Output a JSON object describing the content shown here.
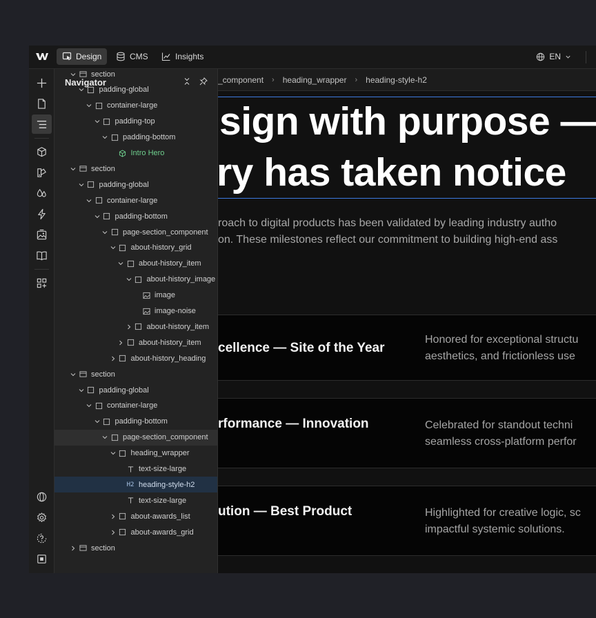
{
  "topbar": {
    "tabs": [
      {
        "label": "Design",
        "icon": "design-cursor-icon",
        "active": true
      },
      {
        "label": "CMS",
        "icon": "database-icon",
        "active": false
      },
      {
        "label": "Insights",
        "icon": "chart-line-icon",
        "active": false
      }
    ],
    "language": "EN"
  },
  "navigator": {
    "title": "Navigator",
    "rows": [
      {
        "label": "section",
        "depth": 0,
        "caret": "down",
        "icon": "section-icon"
      },
      {
        "label": "padding-global",
        "depth": 1,
        "caret": "down",
        "icon": "box-icon"
      },
      {
        "label": "container-large",
        "depth": 2,
        "caret": "down",
        "icon": "box-icon"
      },
      {
        "label": "padding-top",
        "depth": 3,
        "caret": "down",
        "icon": "box-icon"
      },
      {
        "label": "padding-bottom",
        "depth": 4,
        "caret": "down",
        "icon": "box-icon"
      },
      {
        "label": "Intro Hero",
        "depth": 5,
        "caret": "none",
        "icon": "component-icon",
        "state": "component"
      },
      {
        "label": "section",
        "depth": 0,
        "caret": "down",
        "icon": "section-icon"
      },
      {
        "label": "padding-global",
        "depth": 1,
        "caret": "down",
        "icon": "box-icon"
      },
      {
        "label": "container-large",
        "depth": 2,
        "caret": "down",
        "icon": "box-icon"
      },
      {
        "label": "padding-bottom",
        "depth": 3,
        "caret": "down",
        "icon": "box-icon"
      },
      {
        "label": "page-section_component",
        "depth": 4,
        "caret": "down",
        "icon": "box-icon"
      },
      {
        "label": "about-history_grid",
        "depth": 5,
        "caret": "down",
        "icon": "box-icon"
      },
      {
        "label": "about-history_item",
        "depth": 6,
        "caret": "down",
        "icon": "box-icon"
      },
      {
        "label": "about-history_image",
        "depth": 7,
        "caret": "down",
        "icon": "box-icon"
      },
      {
        "label": "image",
        "depth": 8,
        "caret": "none",
        "icon": "image-icon"
      },
      {
        "label": "image-noise",
        "depth": 8,
        "caret": "none",
        "icon": "image-icon"
      },
      {
        "label": "about-history_item",
        "depth": 7,
        "caret": "right",
        "icon": "box-icon"
      },
      {
        "label": "about-history_item",
        "depth": 6,
        "caret": "right",
        "icon": "box-icon"
      },
      {
        "label": "about-history_heading",
        "depth": 5,
        "caret": "right",
        "icon": "box-icon"
      },
      {
        "label": "section",
        "depth": 0,
        "caret": "down",
        "icon": "section-icon"
      },
      {
        "label": "padding-global",
        "depth": 1,
        "caret": "down",
        "icon": "box-icon"
      },
      {
        "label": "container-large",
        "depth": 2,
        "caret": "down",
        "icon": "box-icon"
      },
      {
        "label": "padding-bottom",
        "depth": 3,
        "caret": "down",
        "icon": "box-icon"
      },
      {
        "label": "page-section_component",
        "depth": 4,
        "caret": "down",
        "icon": "box-icon",
        "state": "hover"
      },
      {
        "label": "heading_wrapper",
        "depth": 5,
        "caret": "down",
        "icon": "box-icon"
      },
      {
        "label": "text-size-large",
        "depth": 6,
        "caret": "none",
        "icon": "text-icon"
      },
      {
        "label": "heading-style-h2",
        "depth": 6,
        "caret": "none",
        "icon": "heading-h2-icon",
        "icon_text": "H2",
        "state": "selected"
      },
      {
        "label": "text-size-large",
        "depth": 6,
        "caret": "none",
        "icon": "text-icon"
      },
      {
        "label": "about-awards_list",
        "depth": 5,
        "caret": "right",
        "icon": "box-icon"
      },
      {
        "label": "about-awards_grid",
        "depth": 5,
        "caret": "right",
        "icon": "box-icon"
      },
      {
        "label": "section",
        "depth": 0,
        "caret": "right",
        "icon": "section-icon"
      }
    ]
  },
  "breadcrumb": [
    "_component",
    "heading_wrapper",
    "heading-style-h2"
  ],
  "canvas": {
    "heading_line1": "sign with purpose —",
    "heading_line2": "ry has taken notice",
    "paragraph_line1": "roach to digital products has been validated by leading industry autho",
    "paragraph_line2": "on. These milestones reflect our commitment to building high-end ass",
    "awards": [
      {
        "title": "cellence — Site of the Year",
        "desc_line1": "Honored for exceptional structu",
        "desc_line2": "aesthetics, and frictionless use"
      },
      {
        "title": "rformance — Innovation",
        "desc_line1": "Celebrated for standout techni",
        "desc_line2": "seamless cross-platform perfor"
      },
      {
        "title": "ution — Best Product",
        "desc_line1": "Highlighted for creative logic, sc",
        "desc_line2": "impactful systemic solutions."
      }
    ]
  },
  "colors": {
    "accent_blue": "#3d7ae0",
    "component_green": "#6fcf8e",
    "selected_row": "#213144"
  }
}
